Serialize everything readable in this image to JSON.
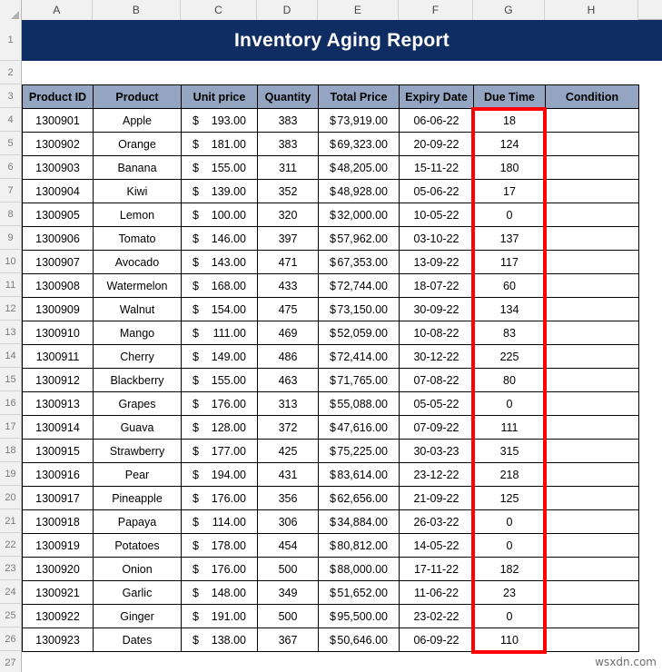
{
  "sheet": {
    "column_letters": [
      "A",
      "B",
      "C",
      "D",
      "E",
      "F",
      "G",
      "H"
    ],
    "row_numbers": [
      "1",
      "2",
      "3",
      "4",
      "5",
      "6",
      "7",
      "8",
      "9",
      "10",
      "11",
      "12",
      "13",
      "14",
      "15",
      "16",
      "17",
      "18",
      "19",
      "20",
      "21",
      "22",
      "23",
      "24",
      "25",
      "26",
      "27"
    ],
    "title": "Inventory Aging Report",
    "title_bg": "#0f2d62",
    "header_bg": "#93a5c0",
    "highlight_color": "#ff0000",
    "watermark": "wsxdn.com"
  },
  "table": {
    "headers": [
      "Product ID",
      "Product",
      "Unit price",
      "Quantity",
      "Total Price",
      "Expiry Date",
      "Due Time",
      "Condition"
    ],
    "currency_symbol": "$",
    "rows": [
      {
        "id": "1300901",
        "product": "Apple",
        "unit_price": "193.00",
        "quantity": "383",
        "total_price": "73,919.00",
        "expiry": "06-06-22",
        "due": "18",
        "condition": ""
      },
      {
        "id": "1300902",
        "product": "Orange",
        "unit_price": "181.00",
        "quantity": "383",
        "total_price": "69,323.00",
        "expiry": "20-09-22",
        "due": "124",
        "condition": ""
      },
      {
        "id": "1300903",
        "product": "Banana",
        "unit_price": "155.00",
        "quantity": "311",
        "total_price": "48,205.00",
        "expiry": "15-11-22",
        "due": "180",
        "condition": ""
      },
      {
        "id": "1300904",
        "product": "Kiwi",
        "unit_price": "139.00",
        "quantity": "352",
        "total_price": "48,928.00",
        "expiry": "05-06-22",
        "due": "17",
        "condition": ""
      },
      {
        "id": "1300905",
        "product": "Lemon",
        "unit_price": "100.00",
        "quantity": "320",
        "total_price": "32,000.00",
        "expiry": "10-05-22",
        "due": "0",
        "condition": ""
      },
      {
        "id": "1300906",
        "product": "Tomato",
        "unit_price": "146.00",
        "quantity": "397",
        "total_price": "57,962.00",
        "expiry": "03-10-22",
        "due": "137",
        "condition": ""
      },
      {
        "id": "1300907",
        "product": "Avocado",
        "unit_price": "143.00",
        "quantity": "471",
        "total_price": "67,353.00",
        "expiry": "13-09-22",
        "due": "117",
        "condition": ""
      },
      {
        "id": "1300908",
        "product": "Watermelon",
        "unit_price": "168.00",
        "quantity": "433",
        "total_price": "72,744.00",
        "expiry": "18-07-22",
        "due": "60",
        "condition": ""
      },
      {
        "id": "1300909",
        "product": "Walnut",
        "unit_price": "154.00",
        "quantity": "475",
        "total_price": "73,150.00",
        "expiry": "30-09-22",
        "due": "134",
        "condition": ""
      },
      {
        "id": "1300910",
        "product": "Mango",
        "unit_price": "111.00",
        "quantity": "469",
        "total_price": "52,059.00",
        "expiry": "10-08-22",
        "due": "83",
        "condition": ""
      },
      {
        "id": "1300911",
        "product": "Cherry",
        "unit_price": "149.00",
        "quantity": "486",
        "total_price": "72,414.00",
        "expiry": "30-12-22",
        "due": "225",
        "condition": ""
      },
      {
        "id": "1300912",
        "product": "Blackberry",
        "unit_price": "155.00",
        "quantity": "463",
        "total_price": "71,765.00",
        "expiry": "07-08-22",
        "due": "80",
        "condition": ""
      },
      {
        "id": "1300913",
        "product": "Grapes",
        "unit_price": "176.00",
        "quantity": "313",
        "total_price": "55,088.00",
        "expiry": "05-05-22",
        "due": "0",
        "condition": ""
      },
      {
        "id": "1300914",
        "product": "Guava",
        "unit_price": "128.00",
        "quantity": "372",
        "total_price": "47,616.00",
        "expiry": "07-09-22",
        "due": "111",
        "condition": ""
      },
      {
        "id": "1300915",
        "product": "Strawberry",
        "unit_price": "177.00",
        "quantity": "425",
        "total_price": "75,225.00",
        "expiry": "30-03-23",
        "due": "315",
        "condition": ""
      },
      {
        "id": "1300916",
        "product": "Pear",
        "unit_price": "194.00",
        "quantity": "431",
        "total_price": "83,614.00",
        "expiry": "23-12-22",
        "due": "218",
        "condition": ""
      },
      {
        "id": "1300917",
        "product": "Pineapple",
        "unit_price": "176.00",
        "quantity": "356",
        "total_price": "62,656.00",
        "expiry": "21-09-22",
        "due": "125",
        "condition": ""
      },
      {
        "id": "1300918",
        "product": "Papaya",
        "unit_price": "114.00",
        "quantity": "306",
        "total_price": "34,884.00",
        "expiry": "26-03-22",
        "due": "0",
        "condition": ""
      },
      {
        "id": "1300919",
        "product": "Potatoes",
        "unit_price": "178.00",
        "quantity": "454",
        "total_price": "80,812.00",
        "expiry": "14-05-22",
        "due": "0",
        "condition": ""
      },
      {
        "id": "1300920",
        "product": "Onion",
        "unit_price": "176.00",
        "quantity": "500",
        "total_price": "88,000.00",
        "expiry": "17-11-22",
        "due": "182",
        "condition": ""
      },
      {
        "id": "1300921",
        "product": "Garlic",
        "unit_price": "148.00",
        "quantity": "349",
        "total_price": "51,652.00",
        "expiry": "11-06-22",
        "due": "23",
        "condition": ""
      },
      {
        "id": "1300922",
        "product": "Ginger",
        "unit_price": "191.00",
        "quantity": "500",
        "total_price": "95,500.00",
        "expiry": "23-02-22",
        "due": "0",
        "condition": ""
      },
      {
        "id": "1300923",
        "product": "Dates",
        "unit_price": "138.00",
        "quantity": "367",
        "total_price": "50,646.00",
        "expiry": "06-09-22",
        "due": "110",
        "condition": ""
      }
    ]
  }
}
